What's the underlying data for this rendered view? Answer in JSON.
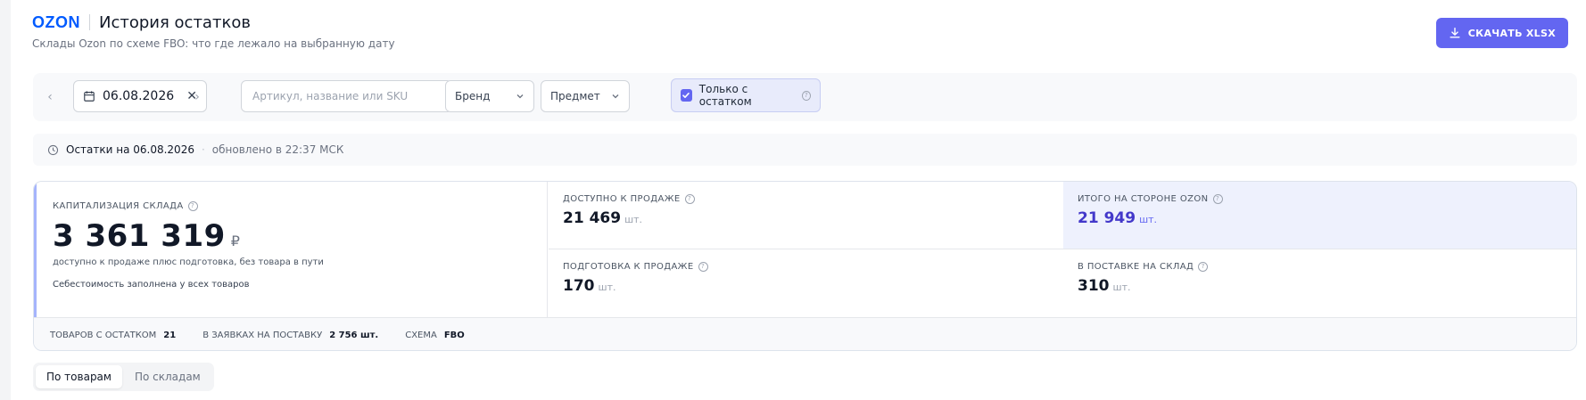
{
  "header": {
    "logo": "OZON",
    "title": "История остатков",
    "subtitle": "Склады Ozon по схеме FBO: что где лежало на выбранную дату",
    "download_label": "СКАЧАТЬ XLSX"
  },
  "filters": {
    "date_value": "06.08.2026",
    "search_placeholder": "Артикул, название или SKU",
    "brand_label": "Бренд",
    "subject_label": "Предмет",
    "only_stock_label": "Только с остатком",
    "only_stock_checked": true
  },
  "status": {
    "main": "Остатки на 06.08.2026",
    "separator": "·",
    "updated": "обновлено в 22:37 МСК"
  },
  "capitalization": {
    "label": "КАПИТАЛИЗАЦИЯ СКЛАДА",
    "value": "3 361 319",
    "currency": "₽",
    "description": "доступно к продаже плюс подготовка, без товара в пути",
    "note": "Себестоимость заполнена у всех товаров"
  },
  "metrics": {
    "available": {
      "label": "ДОСТУПНО К ПРОДАЖЕ",
      "value": "21 469",
      "unit": "шт."
    },
    "total_ozon": {
      "label": "ИТОГО НА СТОРОНЕ OZON",
      "value": "21 949",
      "unit": "шт."
    },
    "preparing": {
      "label": "ПОДГОТОВКА К ПРОДАЖЕ",
      "value": "170",
      "unit": "шт."
    },
    "in_supply": {
      "label": "В ПОСТАВКЕ НА СКЛАД",
      "value": "310",
      "unit": "шт."
    }
  },
  "footer": {
    "items_label": "ТОВАРОВ С ОСТАТКОМ",
    "items_value": "21",
    "orders_label": "В ЗАЯВКАХ НА ПОСТАВКУ",
    "orders_value": "2 756 шт.",
    "scheme_label": "СХЕМА",
    "scheme_value": "FBO"
  },
  "tabs": [
    {
      "label": "По товарам",
      "active": true
    },
    {
      "label": "По складам",
      "active": false
    }
  ],
  "colors": {
    "accent": "#6366f1",
    "brand": "#005bff",
    "highlight_bg": "#eef1fd"
  }
}
